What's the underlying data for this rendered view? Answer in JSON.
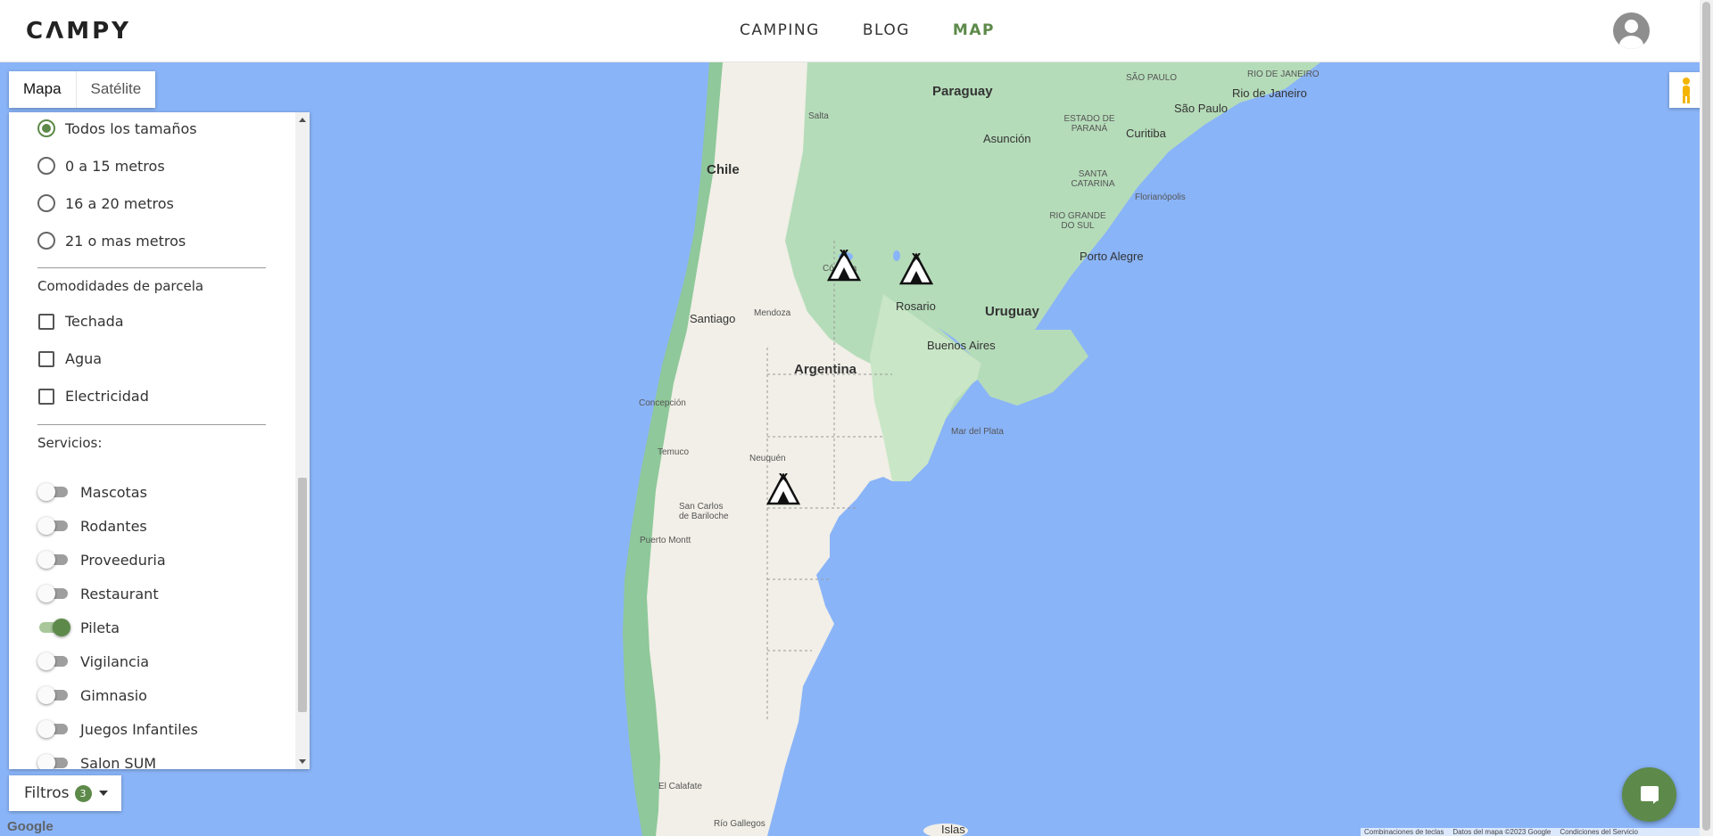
{
  "header": {
    "logo": "CΛMPY",
    "nav": [
      {
        "label": "CAMPING"
      },
      {
        "label": "BLOG"
      },
      {
        "label": "MAP",
        "active": true
      }
    ]
  },
  "map": {
    "type_buttons": [
      "Mapa",
      "Satélite"
    ],
    "selected_type": "Mapa",
    "labels": {
      "paraguay": "Paraguay",
      "chile": "Chile",
      "argentina": "Argentina",
      "uruguay": "Uruguay",
      "sao_paulo": "SÃO PAULO",
      "sao_paulo_city": "São Paulo",
      "rio_de_janeiro": "Rio de Janeiro",
      "rio_de_janeiro_state": "RIO DE JANEIRO",
      "asuncion": "Asunción",
      "curitiba": "Curitiba",
      "parana": "ESTADO DE PARANÁ",
      "santa_catarina": "SANTA CATARINA",
      "florianopolis": "Florianópolis",
      "rio_grande_do_sul": "RIO GRANDE DO SUL",
      "porto_alegre": "Porto Alegre",
      "salta": "Salta",
      "cordoba": "Córdoba",
      "rosario": "Rosario",
      "buenos_aires": "Buenos Aires",
      "santiago": "Santiago",
      "mendoza": "Mendoza",
      "concepcion": "Concepción",
      "temuco": "Temuco",
      "neuquen": "Neuquén",
      "bariloche": "San Carlos de Bariloche",
      "puerto_montt": "Puerto Montt",
      "mar_del_plata": "Mar del Plata",
      "el_calafate": "El Calafate",
      "rio_gallegos": "Río Gallegos",
      "islas": "Islas"
    },
    "attribution": [
      "Combinaciones de teclas",
      "Datos del mapa ©2023 Google",
      "Condiciones del Servicio"
    ],
    "google_logo": "Google"
  },
  "filters": {
    "size_options": [
      {
        "label": "Todos los tamaños",
        "selected": true
      },
      {
        "label": "0 a 15 metros",
        "selected": false
      },
      {
        "label": "16 a 20 metros",
        "selected": false
      },
      {
        "label": "21 o mas metros",
        "selected": false
      }
    ],
    "amenities_title": "Comodidades de parcela",
    "amenities": [
      {
        "label": "Techada",
        "checked": false
      },
      {
        "label": "Agua",
        "checked": false
      },
      {
        "label": "Electricidad",
        "checked": false
      }
    ],
    "services_title": "Servicios:",
    "services": [
      {
        "label": "Mascotas",
        "on": false
      },
      {
        "label": "Rodantes",
        "on": false
      },
      {
        "label": "Proveeduria",
        "on": false
      },
      {
        "label": "Restaurant",
        "on": false
      },
      {
        "label": "Pileta",
        "on": true
      },
      {
        "label": "Vigilancia",
        "on": false
      },
      {
        "label": "Gimnasio",
        "on": false
      },
      {
        "label": "Juegos Infantiles",
        "on": false
      },
      {
        "label": "Salon SUM",
        "on": false
      }
    ],
    "toggle_label": "Filtros",
    "count": "3"
  },
  "colors": {
    "accent": "#5d8a4a",
    "water": "#8ab4f8",
    "land": "#f1efe7",
    "vegetation": "#a8d5ba"
  }
}
